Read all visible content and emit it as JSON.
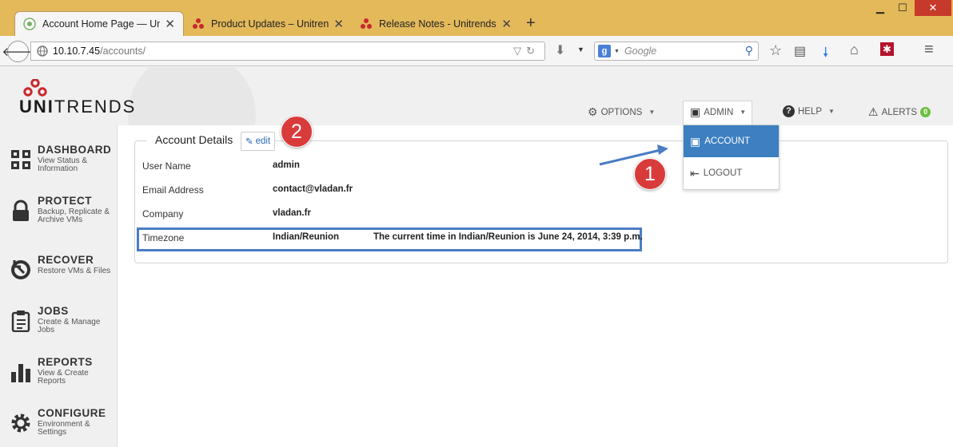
{
  "browser": {
    "tabs": [
      {
        "title": "Account Home Page — Un…",
        "active": true
      },
      {
        "title": "Product Updates – Unitren…",
        "active": false
      },
      {
        "title": "Release Notes - Unitrends …",
        "active": false
      }
    ],
    "new_tab": "+",
    "url_host": "10.10.7.45",
    "url_path": "/accounts/",
    "search_engine": "g",
    "search_placeholder": "Google"
  },
  "app": {
    "logo": {
      "bold": "UNI",
      "rest": "TRENDS"
    },
    "top_nav": [
      {
        "label": "OPTIONS"
      },
      {
        "label": "ADMIN"
      },
      {
        "label": "HELP"
      },
      {
        "label": "ALERTS",
        "badge": "0"
      }
    ],
    "admin_menu": [
      {
        "label": "ACCOUNT",
        "active": true
      },
      {
        "label": "LOGOUT",
        "active": false
      }
    ],
    "sidebar": [
      {
        "title": "DASHBOARD",
        "subtitle": "View Status & Information",
        "icon": "grid-icon"
      },
      {
        "title": "PROTECT",
        "subtitle": "Backup, Replicate & Archive VMs",
        "icon": "lock-icon"
      },
      {
        "title": "RECOVER",
        "subtitle": "Restore VMs & Files",
        "icon": "restore-icon"
      },
      {
        "title": "JOBS",
        "subtitle": "Create & Manage Jobs",
        "icon": "clipboard-icon"
      },
      {
        "title": "REPORTS",
        "subtitle": "View & Create Reports",
        "icon": "bar-chart-icon"
      },
      {
        "title": "CONFIGURE",
        "subtitle": "Environment & Settings",
        "icon": "gear-icon"
      }
    ],
    "account_details": {
      "legend": "Account Details",
      "edit_label": "edit",
      "rows": [
        {
          "label": "User Name",
          "value": "admin"
        },
        {
          "label": "Email Address",
          "value": "contact@vladan.fr"
        },
        {
          "label": "Company",
          "value": "vladan.fr"
        },
        {
          "label": "Timezone",
          "value": "Indian/Reunion",
          "note": "The current time in Indian/Reunion is June 24, 2014, 3:39 p.m."
        }
      ]
    },
    "callouts": [
      "1",
      "2"
    ],
    "colors": {
      "accent": "#3d7fc1",
      "callout": "#d93b3b",
      "highlight": "#4a7cc4",
      "alert_badge": "#6cbf3f"
    }
  }
}
